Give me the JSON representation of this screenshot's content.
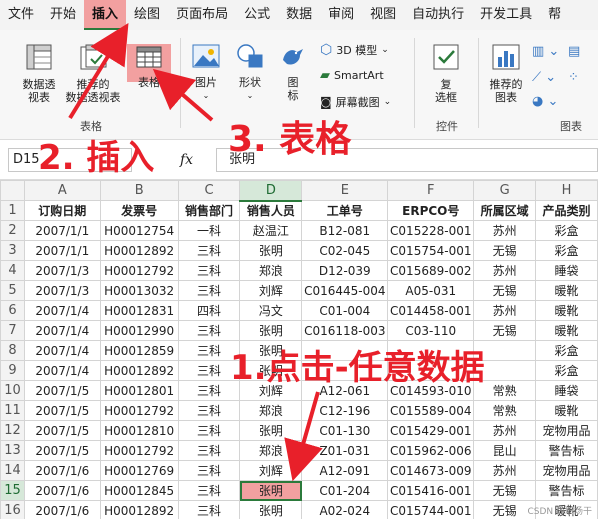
{
  "menu": {
    "items": [
      "文件",
      "开始",
      "插入",
      "绘图",
      "页面布局",
      "公式",
      "数据",
      "审阅",
      "视图",
      "自动执行",
      "开发工具",
      "帮"
    ],
    "active_index": 2
  },
  "ribbon": {
    "pivot_table": "数据透\n视表",
    "recommended_pivot": "推荐的\n数据透视表",
    "table": "表格",
    "pictures": "图片",
    "shapes": "形状",
    "icons": "图\n标",
    "models_3d": "3D 模型",
    "smartart": "SmartArt",
    "screenshot": "屏幕截图",
    "checkbox": "复\n选框",
    "recommended_charts": "推荐的\n图表",
    "group_tables": "表格",
    "group_controls": "控件",
    "group_charts": "图表",
    "accent": "#217346"
  },
  "formula_bar": {
    "name_box": "D15",
    "fx": "fx",
    "value": "张明"
  },
  "sheet": {
    "columns": [
      "A",
      "B",
      "C",
      "D",
      "E",
      "F",
      "G",
      "H"
    ],
    "selected_column": "D",
    "selected_row": 15,
    "rows": [
      {
        "n": "1",
        "cells": [
          "订购日期",
          "发票号",
          "销售部门",
          "销售人员",
          "工单号",
          "ERPCO号",
          "所属区域",
          "产品类别"
        ]
      },
      {
        "n": "2",
        "cells": [
          "2007/1/1",
          "H00012754",
          "一科",
          "赵温江",
          "B12-081",
          "C015228-001",
          "苏州",
          "彩盒"
        ]
      },
      {
        "n": "3",
        "cells": [
          "2007/1/1",
          "H00012892",
          "三科",
          "张明",
          "C02-045",
          "C015754-001",
          "无锡",
          "彩盒"
        ]
      },
      {
        "n": "4",
        "cells": [
          "2007/1/3",
          "H00012792",
          "三科",
          "郑浪",
          "D12-039",
          "C015689-002",
          "苏州",
          "睡袋"
        ]
      },
      {
        "n": "5",
        "cells": [
          "2007/1/3",
          "H00013032",
          "三科",
          "刘辉",
          "C016445-004",
          "A05-031",
          "无锡",
          "暖靴"
        ]
      },
      {
        "n": "6",
        "cells": [
          "2007/1/4",
          "H00012831",
          "四科",
          "冯文",
          "C01-004",
          "C014458-001",
          "苏州",
          "暖靴"
        ]
      },
      {
        "n": "7",
        "cells": [
          "2007/1/4",
          "H00012990",
          "三科",
          "张明",
          "C016118-003",
          "C03-110",
          "无锡",
          "暖靴"
        ]
      },
      {
        "n": "8",
        "cells": [
          "2007/1/4",
          "H00012859",
          "三科",
          "张明",
          "",
          "",
          "",
          "彩盒"
        ]
      },
      {
        "n": "9",
        "cells": [
          "2007/1/4",
          "H00012892",
          "三科",
          "张明",
          "",
          "",
          "",
          "彩盒"
        ]
      },
      {
        "n": "10",
        "cells": [
          "2007/1/5",
          "H00012801",
          "三科",
          "刘辉",
          "A12-061",
          "C014593-010",
          "常熟",
          "睡袋"
        ]
      },
      {
        "n": "11",
        "cells": [
          "2007/1/5",
          "H00012792",
          "三科",
          "郑浪",
          "C12-196",
          "C015589-004",
          "常熟",
          "暖靴"
        ]
      },
      {
        "n": "12",
        "cells": [
          "2007/1/5",
          "H00012810",
          "三科",
          "张明",
          "C01-130",
          "C015429-001",
          "苏州",
          "宠物用品"
        ]
      },
      {
        "n": "13",
        "cells": [
          "2007/1/5",
          "H00012792",
          "三科",
          "郑浪",
          "Z01-031",
          "C015962-006",
          "昆山",
          "警告标"
        ]
      },
      {
        "n": "14",
        "cells": [
          "2007/1/6",
          "H00012769",
          "三科",
          "刘辉",
          "A12-091",
          "C014673-009",
          "苏州",
          "宠物用品"
        ]
      },
      {
        "n": "15",
        "cells": [
          "2007/1/6",
          "H00012845",
          "三科",
          "张明",
          "C01-204",
          "C015416-001",
          "无锡",
          "警告标"
        ]
      },
      {
        "n": "16",
        "cells": [
          "2007/1/6",
          "H00012892",
          "三科",
          "张明",
          "A02-024",
          "C015744-001",
          "无锡",
          "暖靴"
        ]
      }
    ]
  },
  "annotations": {
    "step1": "1.点击-任意数据",
    "step2": "2. 插入",
    "step3": "3. 表格",
    "color": "#e8202a"
  },
  "watermark": "CSDN @职场干"
}
